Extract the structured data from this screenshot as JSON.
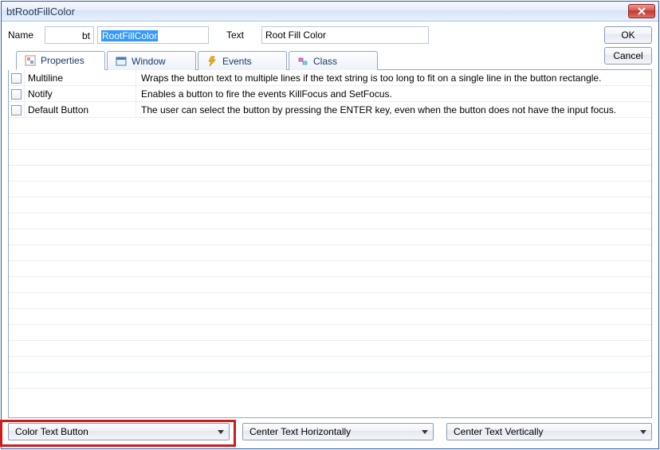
{
  "window": {
    "title": "btRootFillColor"
  },
  "header": {
    "name_label": "Name",
    "prefix_label": "bt",
    "name_value": "RootFillColor",
    "text_label": "Text",
    "text_value": "Root Fill Color"
  },
  "buttons": {
    "ok": "OK",
    "cancel": "Cancel"
  },
  "tabs": {
    "properties": "Properties",
    "window": "Window",
    "events": "Events",
    "class": "Class"
  },
  "properties": [
    {
      "name": "Multiline",
      "desc": "Wraps the button text to multiple lines if the text string is too long to fit on a single line in the button rectangle."
    },
    {
      "name": "Notify",
      "desc": "Enables a button to fire the events KillFocus and SetFocus."
    },
    {
      "name": "Default Button",
      "desc": "The user can select the button by pressing the ENTER key, even when the button does not have the input focus."
    }
  ],
  "bottom": {
    "combo1": "Color Text Button",
    "combo2": "Center Text Horizontally",
    "combo3": "Center Text Vertically"
  }
}
